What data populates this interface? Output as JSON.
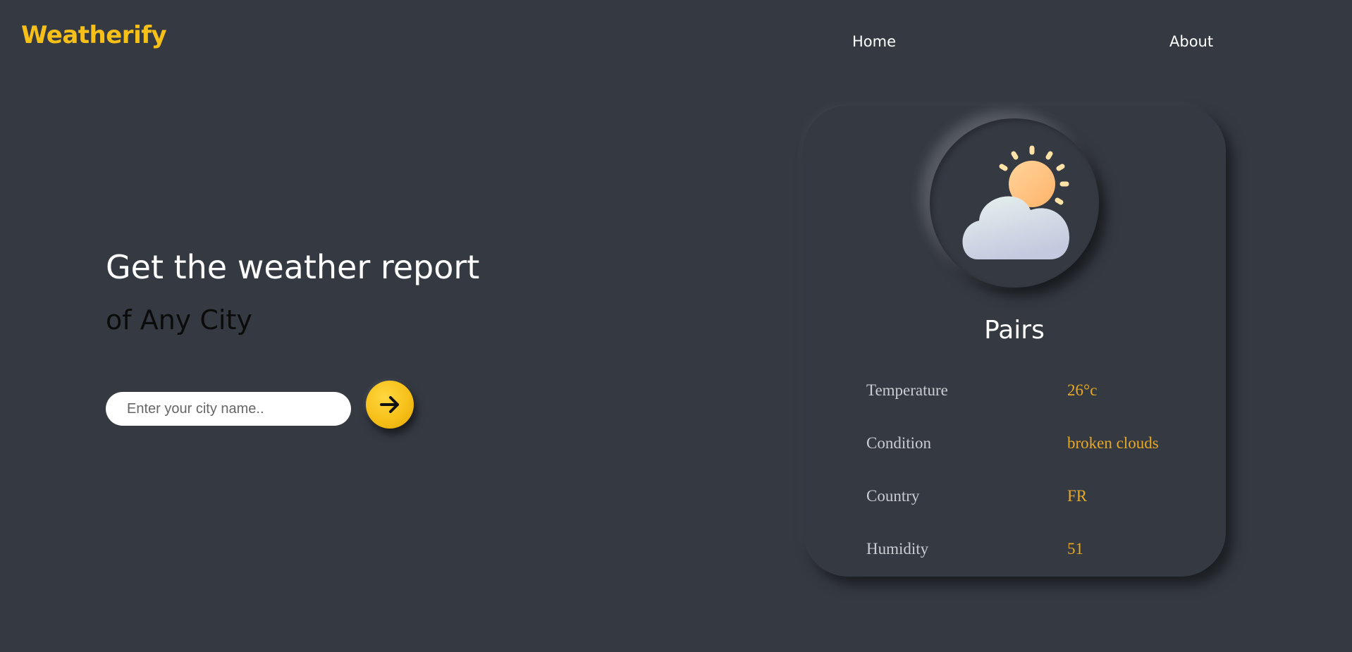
{
  "app": {
    "logo": "Weatherify"
  },
  "nav": {
    "home": "Home",
    "about": "About"
  },
  "hero": {
    "title": "Get the weather report",
    "subtitle": "of Any City"
  },
  "search": {
    "placeholder": "Enter your city name..",
    "value": "",
    "button_icon": "arrow-right-icon"
  },
  "card": {
    "icon": "partly-cloudy-icon",
    "city": "Pairs",
    "rows": [
      {
        "label": "Temperature",
        "value": "26°c"
      },
      {
        "label": "Condition",
        "value": "broken clouds"
      },
      {
        "label": "Country",
        "value": "FR"
      },
      {
        "label": "Humidity",
        "value": "51"
      }
    ]
  },
  "colors": {
    "background": "#353a42",
    "accent": "#f7c019",
    "value_text": "#e7a823"
  }
}
